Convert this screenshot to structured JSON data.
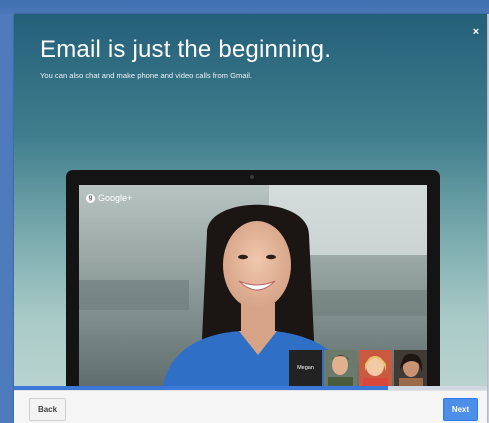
{
  "dialog": {
    "headline": "Email is just the beginning.",
    "subline": "You can also chat and make phone and video calls from Gmail.",
    "close_glyph": "×"
  },
  "video": {
    "brand": "Google+",
    "brand_badge": "g",
    "thumbnail_label": "Megan"
  },
  "progress": {
    "fraction": 0.79
  },
  "footer": {
    "back_label": "Back",
    "next_label": "Next"
  },
  "colors": {
    "accent": "#4d8fe8",
    "progress": "#3b78d8",
    "page_background": "#4a78b8"
  },
  "icons": {
    "close": "close-icon",
    "brand": "google-plus-icon"
  }
}
